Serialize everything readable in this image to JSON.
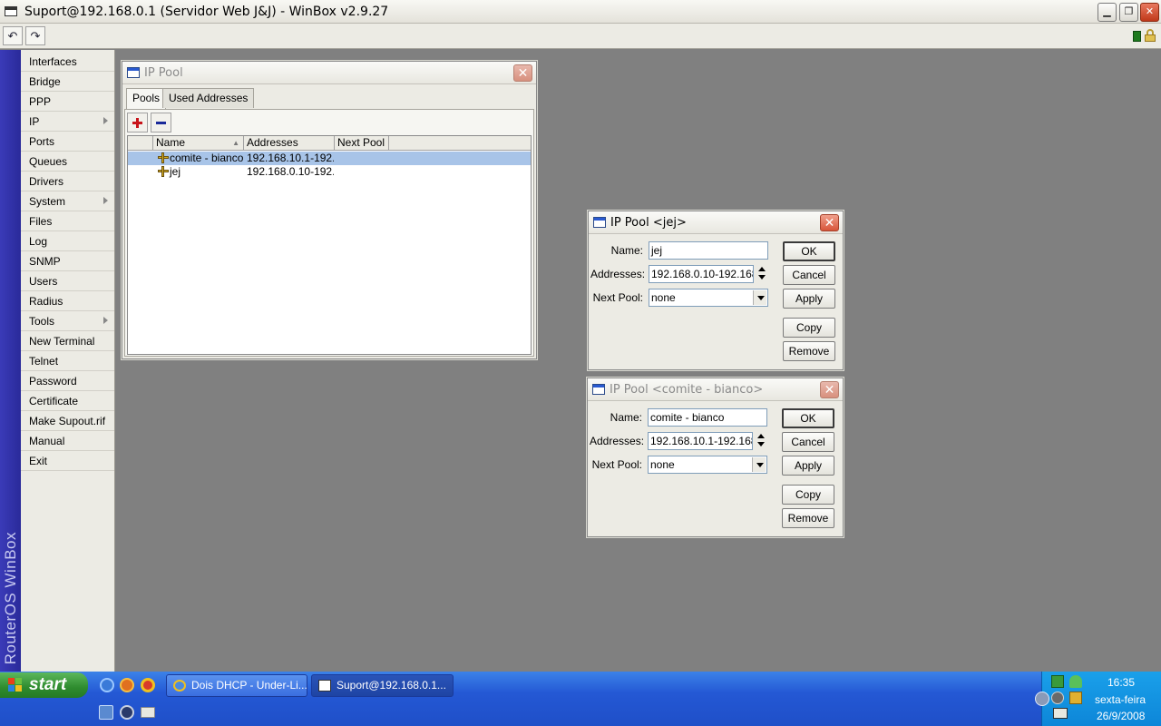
{
  "window": {
    "title": "Suport@192.168.0.1 (Servidor Web J&J) - WinBox v2.9.27",
    "min_glyph": "▁",
    "max_glyph": "❐",
    "close_glyph": "✕"
  },
  "toolbar": {
    "undo_glyph": "↶",
    "redo_glyph": "↷"
  },
  "brand": {
    "text": "RouterOS WinBox"
  },
  "menu": {
    "items": [
      {
        "label": "Interfaces"
      },
      {
        "label": "Bridge"
      },
      {
        "label": "PPP"
      },
      {
        "label": "IP"
      },
      {
        "label": "Ports"
      },
      {
        "label": "Queues"
      },
      {
        "label": "Drivers"
      },
      {
        "label": "System"
      },
      {
        "label": "Files"
      },
      {
        "label": "Log"
      },
      {
        "label": "SNMP"
      },
      {
        "label": "Users"
      },
      {
        "label": "Radius"
      },
      {
        "label": "Tools"
      },
      {
        "label": "New Terminal"
      },
      {
        "label": "Telnet"
      },
      {
        "label": "Password"
      },
      {
        "label": "Certificate"
      },
      {
        "label": "Make Supout.rif"
      },
      {
        "label": "Manual"
      },
      {
        "label": "Exit"
      }
    ]
  },
  "pool_window": {
    "title": "IP Pool",
    "tabs": [
      {
        "label": "Pools"
      },
      {
        "label": "Used Addresses"
      }
    ],
    "columns": [
      {
        "label": "Name"
      },
      {
        "label": "Addresses"
      },
      {
        "label": "Next Pool"
      }
    ],
    "rows": [
      {
        "name": "comite - bianco",
        "addresses": "192.168.10.1-192...",
        "next_pool": ""
      },
      {
        "name": "jej",
        "addresses": "192.168.0.10-192...",
        "next_pool": ""
      }
    ]
  },
  "dialog_jej": {
    "title": "IP Pool <jej>",
    "name_label": "Name:",
    "name_value": "jej",
    "addresses_label": "Addresses:",
    "addresses_value": "192.168.0.10-192.168.",
    "next_pool_label": "Next Pool:",
    "next_pool_value": "none",
    "buttons": {
      "ok": "OK",
      "cancel": "Cancel",
      "apply": "Apply",
      "copy": "Copy",
      "remove": "Remove"
    }
  },
  "dialog_comite": {
    "title": "IP Pool <comite - bianco>",
    "name_label": "Name:",
    "name_value": "comite - bianco",
    "addresses_label": "Addresses:",
    "addresses_value": "192.168.10.1-192.168.",
    "next_pool_label": "Next Pool:",
    "next_pool_value": "none",
    "buttons": {
      "ok": "OK",
      "cancel": "Cancel",
      "apply": "Apply",
      "copy": "Copy",
      "remove": "Remove"
    }
  },
  "taskbar": {
    "start_label": "start",
    "tasks": [
      {
        "label": "Dois DHCP - Under-Li..."
      },
      {
        "label": "Suport@192.168.0.1..."
      }
    ],
    "clock": {
      "time": "16:35",
      "day": "sexta-feira",
      "date": "26/9/2008"
    }
  },
  "colors": {
    "brand_strip": "#2a2a9a",
    "selected_row": "#a8c4e8",
    "taskbar": "#2458d4",
    "start_button": "#2e8b2e"
  }
}
